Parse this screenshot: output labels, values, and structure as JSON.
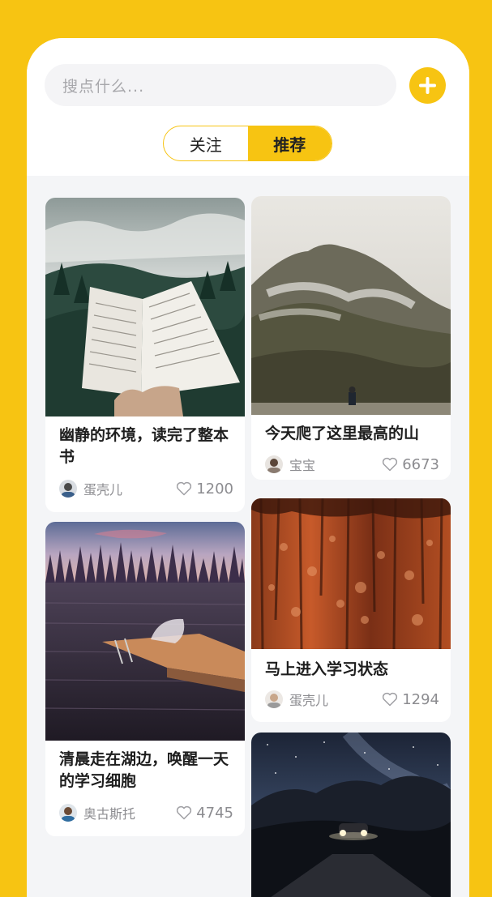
{
  "search": {
    "placeholder": "搜点什么..."
  },
  "tabs": [
    {
      "label": "关注",
      "active": false
    },
    {
      "label": "推荐",
      "active": true
    }
  ],
  "colors": {
    "accent": "#F7C412",
    "background": "#F4F5F7"
  },
  "feed": [
    {
      "title": "幽静的环境，读完了整本书",
      "author": "蛋壳儿",
      "likes": "1200"
    },
    {
      "title": "今天爬了这里最高的山",
      "author": "宝宝",
      "likes": "6673"
    },
    {
      "title": "清晨走在湖边，唤醒一天的学习细胞",
      "author": "奥古斯托",
      "likes": "4745"
    },
    {
      "title": "马上进入学习状态",
      "author": "蛋壳儿",
      "likes": "1294"
    }
  ]
}
